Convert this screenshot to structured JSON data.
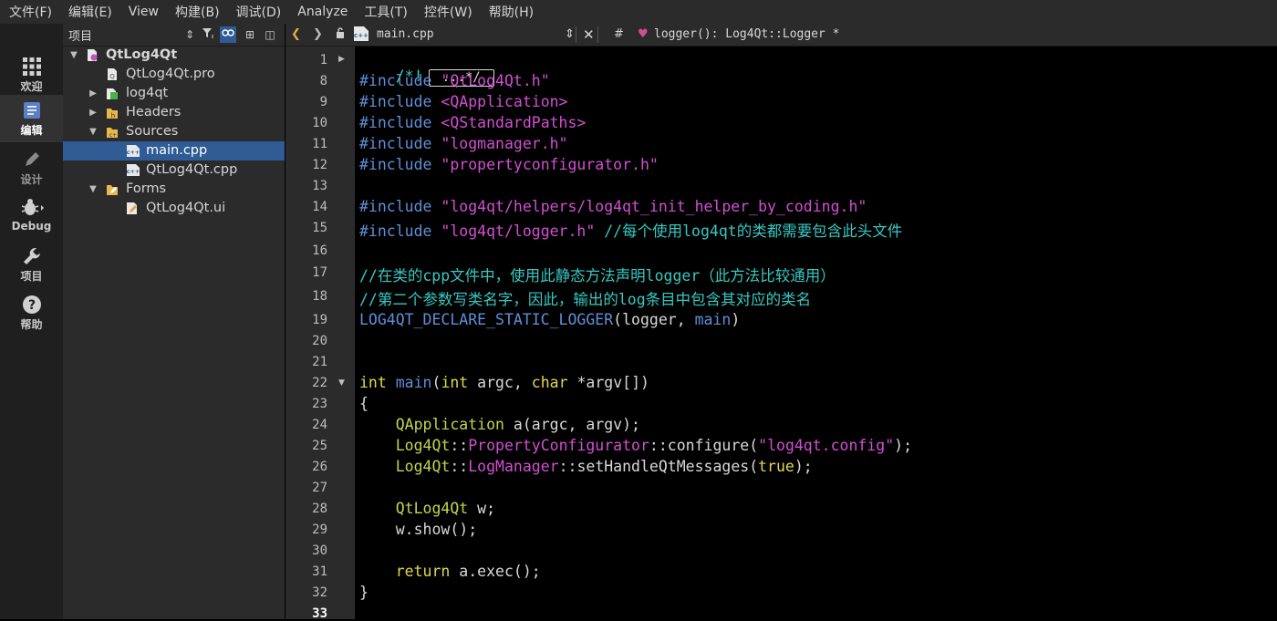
{
  "menu": [
    "文件(F)",
    "编辑(E)",
    "View",
    "构建(B)",
    "调试(D)",
    "Analyze",
    "工具(T)",
    "控件(W)",
    "帮助(H)"
  ],
  "modes": [
    {
      "label": "欢迎",
      "icon": "grid-icon"
    },
    {
      "label": "编辑",
      "icon": "document-icon"
    },
    {
      "label": "设计",
      "icon": "pencil-icon"
    },
    {
      "label": "Debug",
      "icon": "bug-icon"
    },
    {
      "label": "项目",
      "icon": "wrench-icon"
    },
    {
      "label": "帮助",
      "icon": "help-icon"
    }
  ],
  "project_panel": {
    "title": "项目",
    "tree": [
      {
        "label": "QtLog4Qt",
        "level": 0,
        "expanded": true,
        "icon": "qt-project-icon"
      },
      {
        "label": "QtLog4Qt.pro",
        "level": 1,
        "icon": "pro-file-icon"
      },
      {
        "label": "log4qt",
        "level": 1,
        "expanded": false,
        "icon": "subproject-icon"
      },
      {
        "label": "Headers",
        "level": 1,
        "expanded": false,
        "icon": "headers-folder-icon"
      },
      {
        "label": "Sources",
        "level": 1,
        "expanded": true,
        "icon": "sources-folder-icon"
      },
      {
        "label": "main.cpp",
        "level": 2,
        "selected": true,
        "icon": "cpp-file-icon"
      },
      {
        "label": "QtLog4Qt.cpp",
        "level": 2,
        "icon": "cpp-file-icon"
      },
      {
        "label": "Forms",
        "level": 1,
        "expanded": true,
        "icon": "forms-folder-icon"
      },
      {
        "label": "QtLog4Qt.ui",
        "level": 2,
        "icon": "ui-file-icon"
      }
    ]
  },
  "editor": {
    "file_name": "main.cpp",
    "hash": "#",
    "symbol": "logger(): Log4Qt::Logger *",
    "fold_placeholder": "...*/",
    "line_numbers": [
      "1",
      "8",
      "9",
      "10",
      "11",
      "12",
      "13",
      "14",
      "15",
      "16",
      "17",
      "18",
      "19",
      "20",
      "21",
      "22",
      "23",
      "24",
      "25",
      "26",
      "27",
      "28",
      "29",
      "30",
      "31",
      "32",
      "33"
    ],
    "current_line": "33",
    "code": {
      "l1": "/*!",
      "inc_kw": "#include",
      "l8": "\"QtLog4Qt.h\"",
      "l9": "<QApplication>",
      "l10": "<QStandardPaths>",
      "l11": "\"logmanager.h\"",
      "l12": "\"propertyconfigurator.h\"",
      "l14": "\"log4qt/helpers/log4qt_init_helper_by_coding.h\"",
      "l15": "\"log4qt/logger.h\"",
      "l15c": "//每个使用log4qt的类都需要包含此头文件",
      "l17": "//在类的cpp文件中，使用此静态方法声明logger（此方法比较通用）",
      "l18": "//第二个参数写类名字，因此，输出的log条目中包含其对应的类名",
      "l19a": "LOG4QT_DECLARE_STATIC_LOGGER",
      "l19b": "(logger, ",
      "l19c": "main",
      "l19d": ")",
      "l22a": "int",
      "l22b": "main",
      "l22c": "(",
      "l22d": "int",
      "l22e": " argc, ",
      "l22f": "char",
      "l22g": " *argv[])",
      "l23": "{",
      "l24a": "QApplication",
      "l24b": " a(argc, argv);",
      "l25a": "Log4Qt",
      "l25b": "::",
      "l25c": "PropertyConfigurator",
      "l25d": "::configure(",
      "l25e": "\"log4qt.config\"",
      "l25f": ");",
      "l26a": "Log4Qt",
      "l26b": "::",
      "l26c": "LogManager",
      "l26d": "::setHandleQtMessages(",
      "l26e": "true",
      "l26f": ");",
      "l28a": "QtLog4Qt",
      "l28b": " w;",
      "l29": "w.show();",
      "l31a": "return",
      "l31b": " a.exec();",
      "l32": "}"
    }
  }
}
